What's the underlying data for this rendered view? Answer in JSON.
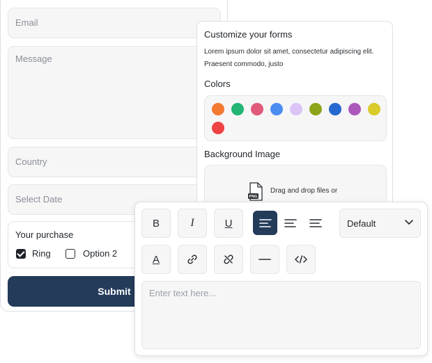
{
  "form": {
    "email_placeholder": "Email",
    "message_placeholder": "Message",
    "country_placeholder": "Country",
    "date_placeholder": "Select Date",
    "purchase_title": "Your purchase",
    "options": [
      {
        "label": "Ring",
        "checked": true
      },
      {
        "label": "Option 2",
        "checked": false
      }
    ],
    "submit_label": "Submit"
  },
  "customize": {
    "title": "Customize your forms",
    "description": "Lorem ipsum dolor sit amet, consectetur adipiscing elit. Praesent commodo, justo",
    "colors_title": "Colors",
    "colors": [
      "#f47a32",
      "#22b574",
      "#e15a7b",
      "#4a8df0",
      "#dcc3f5",
      "#8ca41a",
      "#2568d0",
      "#ac58bb",
      "#d8cb2a",
      "#ef4343"
    ],
    "background_title": "Background Image",
    "upload_icon": "png-file-icon",
    "drop_text": "Drag and drop files or"
  },
  "editor": {
    "toolbar": {
      "bold": "B",
      "italic": "I",
      "underline": "U",
      "font_color": "A",
      "link_icon": "link-icon",
      "unlink_icon": "unlink-icon",
      "hr_icon": "horizontal-rule-icon",
      "code_icon": "code-icon",
      "align_left_icon": "align-left-icon",
      "align_center_icon": "align-center-icon",
      "align_right_icon": "align-right-icon",
      "active_alignment": "left"
    },
    "style_select": "Default",
    "placeholder": "Enter text here..."
  },
  "colors": {
    "primary": "#243b5a",
    "field_bg": "#f6f6f7",
    "border": "#e3e5e8"
  }
}
